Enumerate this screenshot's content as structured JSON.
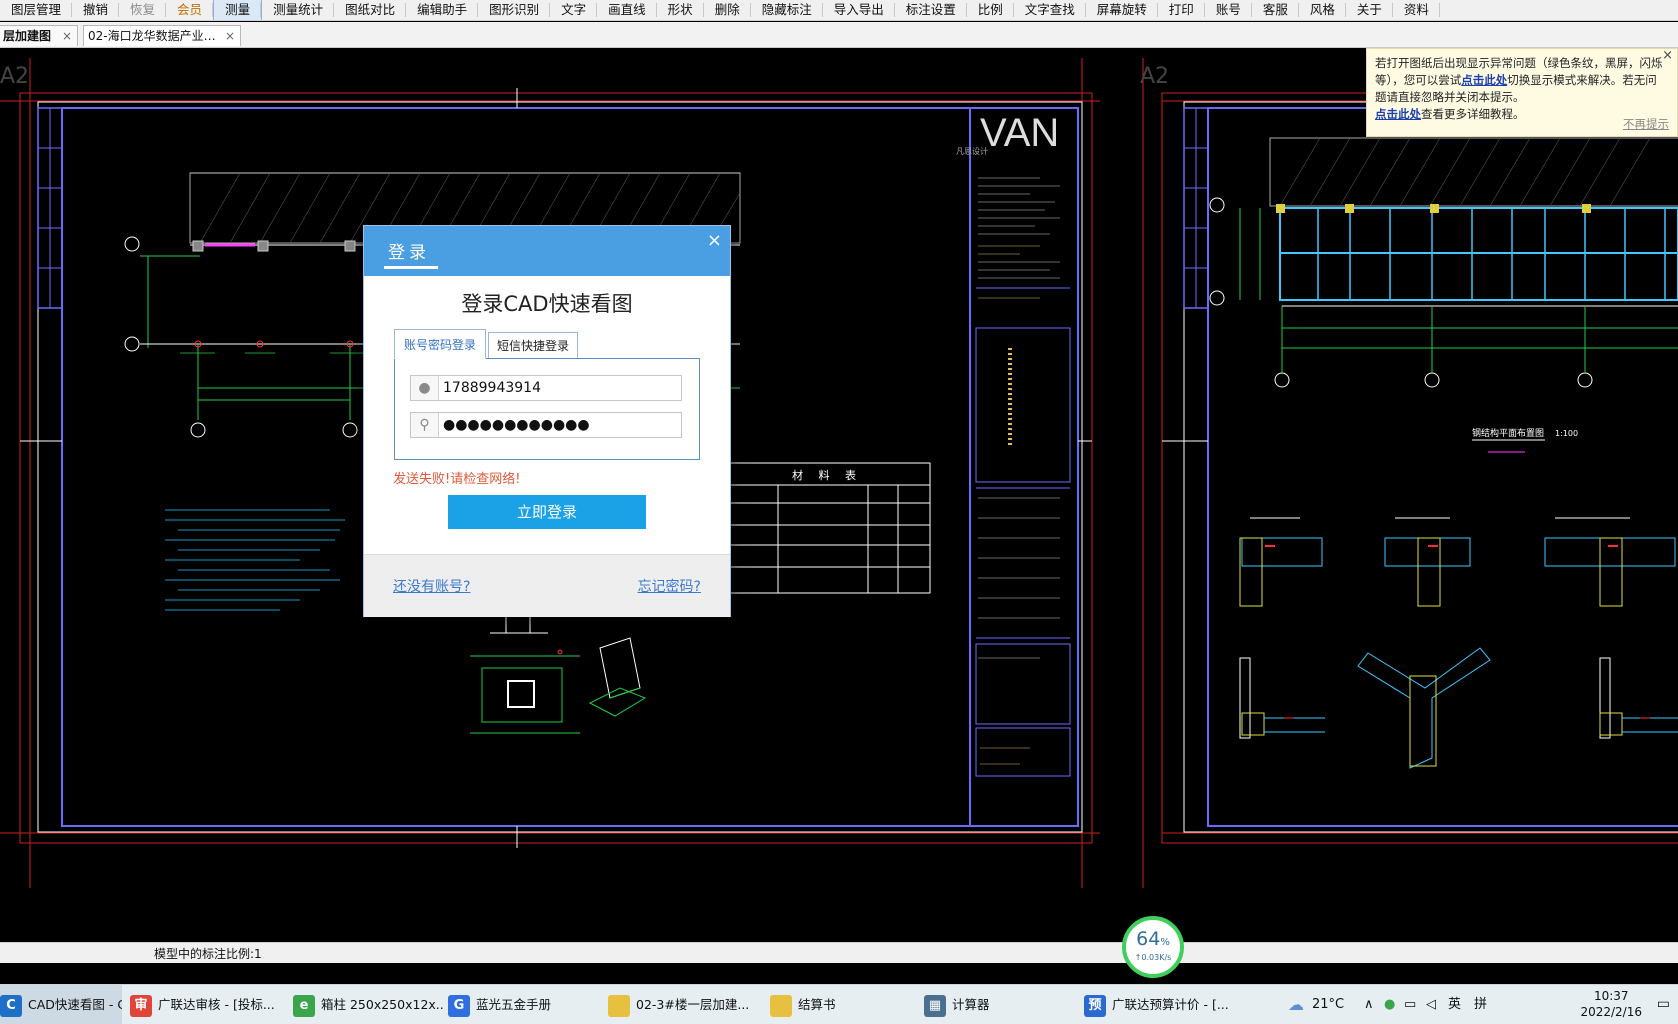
{
  "menu": {
    "items": [
      {
        "label": "图层管理",
        "state": "normal"
      },
      {
        "label": "撤销",
        "state": "normal"
      },
      {
        "label": "恢复",
        "state": "disabled"
      },
      {
        "label": "会员",
        "state": "vip"
      },
      {
        "label": "测量",
        "state": "active"
      },
      {
        "label": "测量统计",
        "state": "normal"
      },
      {
        "label": "图纸对比",
        "state": "normal"
      },
      {
        "label": "编辑助手",
        "state": "normal"
      },
      {
        "label": "图形识别",
        "state": "normal"
      },
      {
        "label": "文字",
        "state": "normal"
      },
      {
        "label": "画直线",
        "state": "normal"
      },
      {
        "label": "形状",
        "state": "normal"
      },
      {
        "label": "删除",
        "state": "normal"
      },
      {
        "label": "隐藏标注",
        "state": "normal"
      },
      {
        "label": "导入导出",
        "state": "normal"
      },
      {
        "label": "标注设置",
        "state": "normal"
      },
      {
        "label": "比例",
        "state": "normal"
      },
      {
        "label": "文字查找",
        "state": "normal"
      },
      {
        "label": "屏幕旋转",
        "state": "normal"
      },
      {
        "label": "打印",
        "state": "normal"
      },
      {
        "label": "账号",
        "state": "normal"
      },
      {
        "label": "客服",
        "state": "normal"
      },
      {
        "label": "风格",
        "state": "normal"
      },
      {
        "label": "关于",
        "state": "normal"
      },
      {
        "label": "资料",
        "state": "normal"
      }
    ]
  },
  "tabs": [
    {
      "label": "层加建图",
      "close": "×"
    },
    {
      "label": "02-海口龙华数据产业…",
      "close": "×"
    }
  ],
  "notice": {
    "text1": "若打开图纸后出现显示异常问题（绿色条纹，黑屏，闪烁等），您可以尝试",
    "link1": "点击此处",
    "text2": "切换显示模式来解决。若无问题请直接忽略并关闭本提示。",
    "link2": "点击此处",
    "text3": "查看更多详细教程。",
    "dismiss": "不再提示",
    "close": "×"
  },
  "login": {
    "header": "登录",
    "close": "×",
    "heading": "登录CAD快速看图",
    "tab_password": "账号密码登录",
    "tab_sms": "短信快捷登录",
    "phone": "17889943914",
    "password": "●●●●●●●●●●●●",
    "error": "发送失败!请检查网络!",
    "submit": "立即登录",
    "register": "还没有账号?",
    "forgot": "忘记密码?"
  },
  "cad": {
    "sheet_label_left": "A2",
    "sheet_label_right": "A2",
    "logo": "VAN",
    "logo_sub": "凡恩设计",
    "table_title": "材 料 表",
    "grid_left": [
      "H",
      "H",
      "H",
      "H"
    ],
    "plan_title": "钢结构平面布置图",
    "plan_scale": "1:100"
  },
  "status": {
    "scale_text": "模型中的标注比例:1"
  },
  "speed": {
    "percent": "64",
    "unit": "%",
    "rate": "↑0.03K/s"
  },
  "taskbar": {
    "items": [
      {
        "label": "CAD快速看图 - C:\\...",
        "icon": "cad-app-icon",
        "color": "#1e6fc8",
        "glyph": "C"
      },
      {
        "label": "广联达审核 - [投标...",
        "icon": "audit-app-icon",
        "color": "#e0453a",
        "glyph": "审"
      },
      {
        "label": "箱柱 250x250x12x...",
        "icon": "browser-icon",
        "color": "#3aa54a",
        "glyph": "e"
      },
      {
        "label": "蓝光五金手册",
        "icon": "manual-app-icon",
        "color": "#2f6fe0",
        "glyph": "G"
      },
      {
        "label": "02-3#楼一层加建...",
        "icon": "folder-icon",
        "color": "#e8c040",
        "glyph": ""
      },
      {
        "label": "结算书",
        "icon": "folder-icon",
        "color": "#e8c040",
        "glyph": ""
      },
      {
        "label": "计算器",
        "icon": "calculator-icon",
        "color": "#4a6f8f",
        "glyph": "▦"
      },
      {
        "label": "广联达预算计价 - [...",
        "icon": "budget-app-icon",
        "color": "#2a6ad0",
        "glyph": "预"
      }
    ],
    "weather": "21°C",
    "ime1": "英",
    "ime2": "拼",
    "time": "10:37",
    "date": "2022/2/16"
  }
}
